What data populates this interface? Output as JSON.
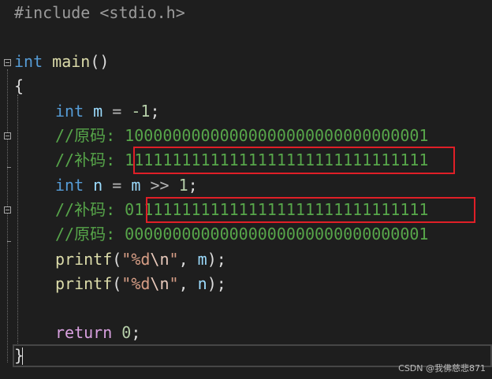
{
  "code": {
    "include_directive": "#include",
    "include_header": "<stdio.h>",
    "main_type": "int",
    "main_name": "main",
    "main_parens": "()",
    "open_brace": "{",
    "decl_m_type": "int",
    "decl_m_name": "m",
    "decl_m_eq": "=",
    "decl_m_value": "-1",
    "decl_m_semi": ";",
    "comment_orig_1": "//原码: 10000000000000000000000000000001",
    "comment_comp_1": "//补码: 11111111111111111111111111111111",
    "decl_n_type": "int",
    "decl_n_name": "n",
    "decl_n_eq": "=",
    "decl_n_src": "m",
    "decl_n_op": ">>",
    "decl_n_value": "1",
    "decl_n_semi": ";",
    "comment_comp_2": "//补码: 01111111111111111111111111111111",
    "comment_orig_2": "//原码: 00000000000000000000000000000001",
    "printf_name": "printf",
    "printf_open": "(",
    "printf_str_open": "\"%d",
    "printf_escape": "\\n",
    "printf_str_close": "\"",
    "printf_comma": ",",
    "printf_arg_m": "m",
    "printf_arg_n": "n",
    "printf_close": ");",
    "return_kw": "return",
    "return_value": "0",
    "return_semi": ";",
    "close_brace": "}"
  },
  "watermark": "CSDN @我佛慈悲871",
  "colors": {
    "background": "#1e1e1e",
    "highlight_border": "#e01f27"
  }
}
